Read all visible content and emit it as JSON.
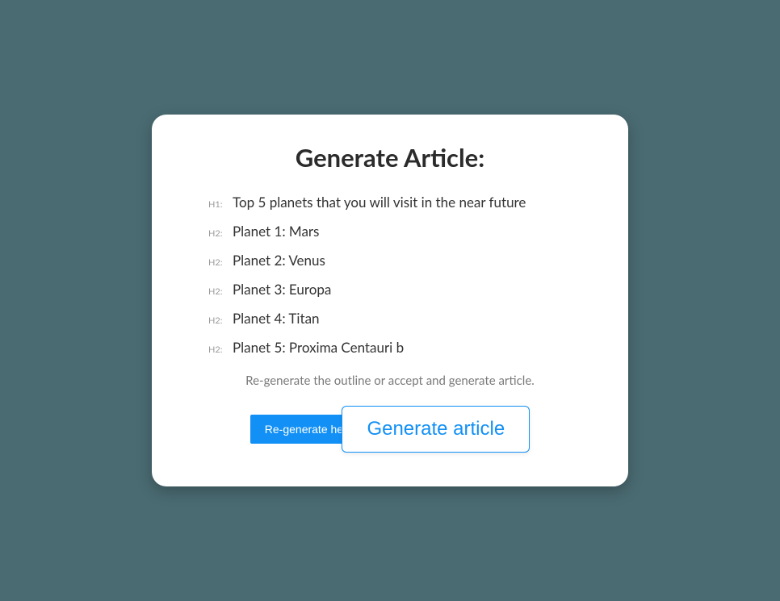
{
  "title": "Generate Article:",
  "outline": {
    "items": [
      {
        "level": "H1:",
        "label": "Top 5 planets that you will visit in the near future"
      },
      {
        "level": "H2:",
        "label": "Planet 1: Mars"
      },
      {
        "level": "H2:",
        "label": "Planet 2: Venus"
      },
      {
        "level": "H2:",
        "label": "Planet 3: Europa"
      },
      {
        "level": "H2:",
        "label": "Planet 4: Titan"
      },
      {
        "level": "H2:",
        "label": "Planet 5: Proxima Centauri b"
      }
    ]
  },
  "helper_text": "Re-generate the outline or accept and generate article.",
  "buttons": {
    "regenerate": "Re-generate headlines",
    "generate": "Generate article"
  }
}
